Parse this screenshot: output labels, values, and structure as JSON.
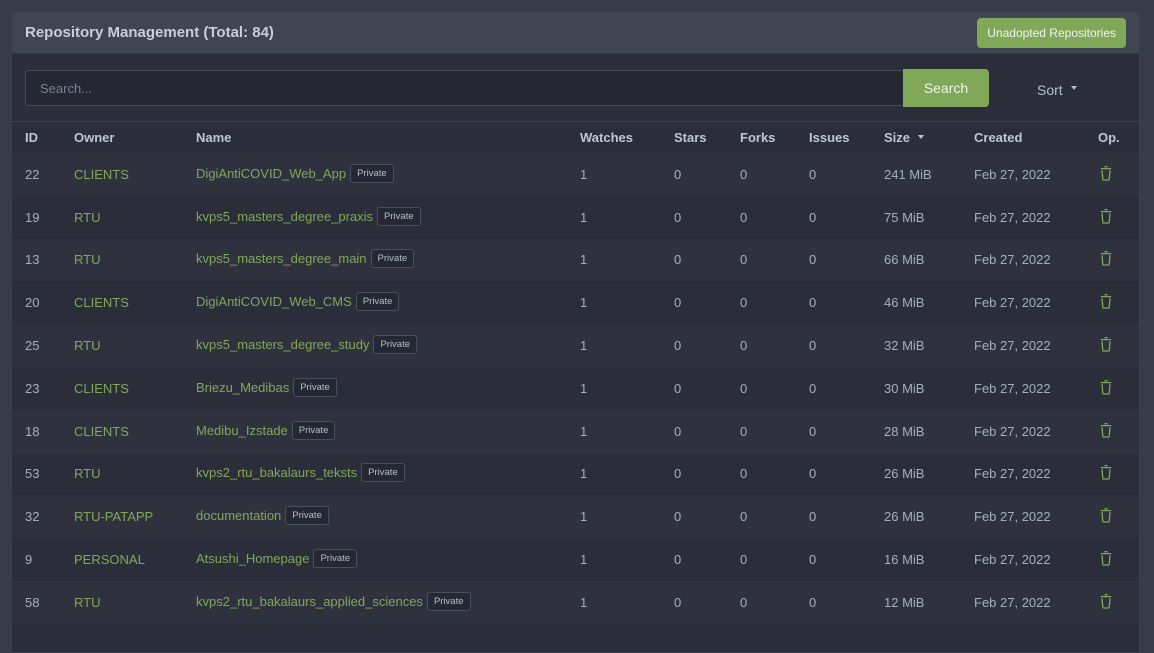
{
  "header": {
    "title": "Repository Management (Total: 84)",
    "unadopted_button": "Unadopted Repositories"
  },
  "search": {
    "placeholder": "Search...",
    "value": "",
    "button": "Search",
    "sort_label": "Sort"
  },
  "colors": {
    "accent": "#7fa859",
    "background": "#383c4a",
    "panel": "#2b2e3a"
  },
  "table": {
    "columns": [
      "ID",
      "Owner",
      "Name",
      "Watches",
      "Stars",
      "Forks",
      "Issues",
      "Size",
      "Created",
      "Op."
    ],
    "sorted_column": "Size",
    "rows": [
      {
        "id": "22",
        "owner": "CLIENTS",
        "name": "DigiAntiCOVID_Web_App",
        "badge": "Private",
        "watches": "1",
        "stars": "0",
        "forks": "0",
        "issues": "0",
        "size": "241 MiB",
        "created": "Feb 27, 2022",
        "op_icon": "trash-icon"
      },
      {
        "id": "19",
        "owner": "RTU",
        "name": "kvps5_masters_degree_praxis",
        "badge": "Private",
        "watches": "1",
        "stars": "0",
        "forks": "0",
        "issues": "0",
        "size": "75 MiB",
        "created": "Feb 27, 2022",
        "op_icon": "trash-icon"
      },
      {
        "id": "13",
        "owner": "RTU",
        "name": "kvps5_masters_degree_main",
        "badge": "Private",
        "watches": "1",
        "stars": "0",
        "forks": "0",
        "issues": "0",
        "size": "66 MiB",
        "created": "Feb 27, 2022",
        "op_icon": "trash-icon"
      },
      {
        "id": "20",
        "owner": "CLIENTS",
        "name": "DigiAntiCOVID_Web_CMS",
        "badge": "Private",
        "watches": "1",
        "stars": "0",
        "forks": "0",
        "issues": "0",
        "size": "46 MiB",
        "created": "Feb 27, 2022",
        "op_icon": "trash-icon"
      },
      {
        "id": "25",
        "owner": "RTU",
        "name": "kvps5_masters_degree_study",
        "badge": "Private",
        "watches": "1",
        "stars": "0",
        "forks": "0",
        "issues": "0",
        "size": "32 MiB",
        "created": "Feb 27, 2022",
        "op_icon": "trash-icon"
      },
      {
        "id": "23",
        "owner": "CLIENTS",
        "name": "Briezu_Medibas",
        "badge": "Private",
        "watches": "1",
        "stars": "0",
        "forks": "0",
        "issues": "0",
        "size": "30 MiB",
        "created": "Feb 27, 2022",
        "op_icon": "trash-icon"
      },
      {
        "id": "18",
        "owner": "CLIENTS",
        "name": "Medibu_Izstade",
        "badge": "Private",
        "watches": "1",
        "stars": "0",
        "forks": "0",
        "issues": "0",
        "size": "28 MiB",
        "created": "Feb 27, 2022",
        "op_icon": "trash-icon"
      },
      {
        "id": "53",
        "owner": "RTU",
        "name": "kvps2_rtu_bakalaurs_teksts",
        "badge": "Private",
        "watches": "1",
        "stars": "0",
        "forks": "0",
        "issues": "0",
        "size": "26 MiB",
        "created": "Feb 27, 2022",
        "op_icon": "trash-icon"
      },
      {
        "id": "32",
        "owner": "RTU-PATAPP",
        "name": "documentation",
        "badge": "Private",
        "watches": "1",
        "stars": "0",
        "forks": "0",
        "issues": "0",
        "size": "26 MiB",
        "created": "Feb 27, 2022",
        "op_icon": "trash-icon"
      },
      {
        "id": "9",
        "owner": "PERSONAL",
        "name": "Atsushi_Homepage",
        "badge": "Private",
        "watches": "1",
        "stars": "0",
        "forks": "0",
        "issues": "0",
        "size": "16 MiB",
        "created": "Feb 27, 2022",
        "op_icon": "trash-icon"
      },
      {
        "id": "58",
        "owner": "RTU",
        "name": "kvps2_rtu_bakalaurs_applied_sciences",
        "badge": "Private",
        "watches": "1",
        "stars": "0",
        "forks": "0",
        "issues": "0",
        "size": "12 MiB",
        "created": "Feb 27, 2022",
        "op_icon": "trash-icon"
      }
    ]
  }
}
